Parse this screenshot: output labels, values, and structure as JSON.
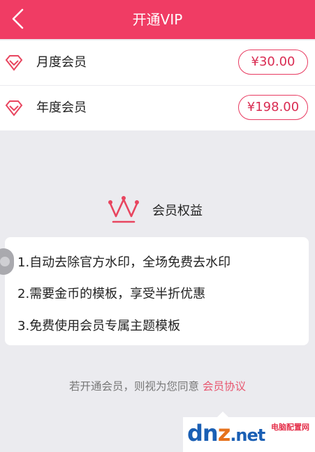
{
  "header": {
    "title": "开通VIP"
  },
  "plans": [
    {
      "name": "月度会员",
      "price": "¥30.00"
    },
    {
      "name": "年度会员",
      "price": "¥198.00"
    }
  ],
  "benefits": {
    "title": "会员权益",
    "items": [
      "1.自动去除官方水印，全场免费去水印",
      "2.需要金币的模板，享受半折优惠",
      "3.免费使用会员专属主题模板"
    ]
  },
  "agreement": {
    "text": "若开通会员，则视为您同意 ",
    "link": "会员协议"
  },
  "watermark": {
    "logo_main": "dn",
    "logo_z": "z",
    "logo_tld": ".net",
    "logo_sub": "电脑配置网"
  },
  "colors": {
    "accent": "#f03c64",
    "price_border": "#e83a60",
    "link": "#e8566f"
  }
}
